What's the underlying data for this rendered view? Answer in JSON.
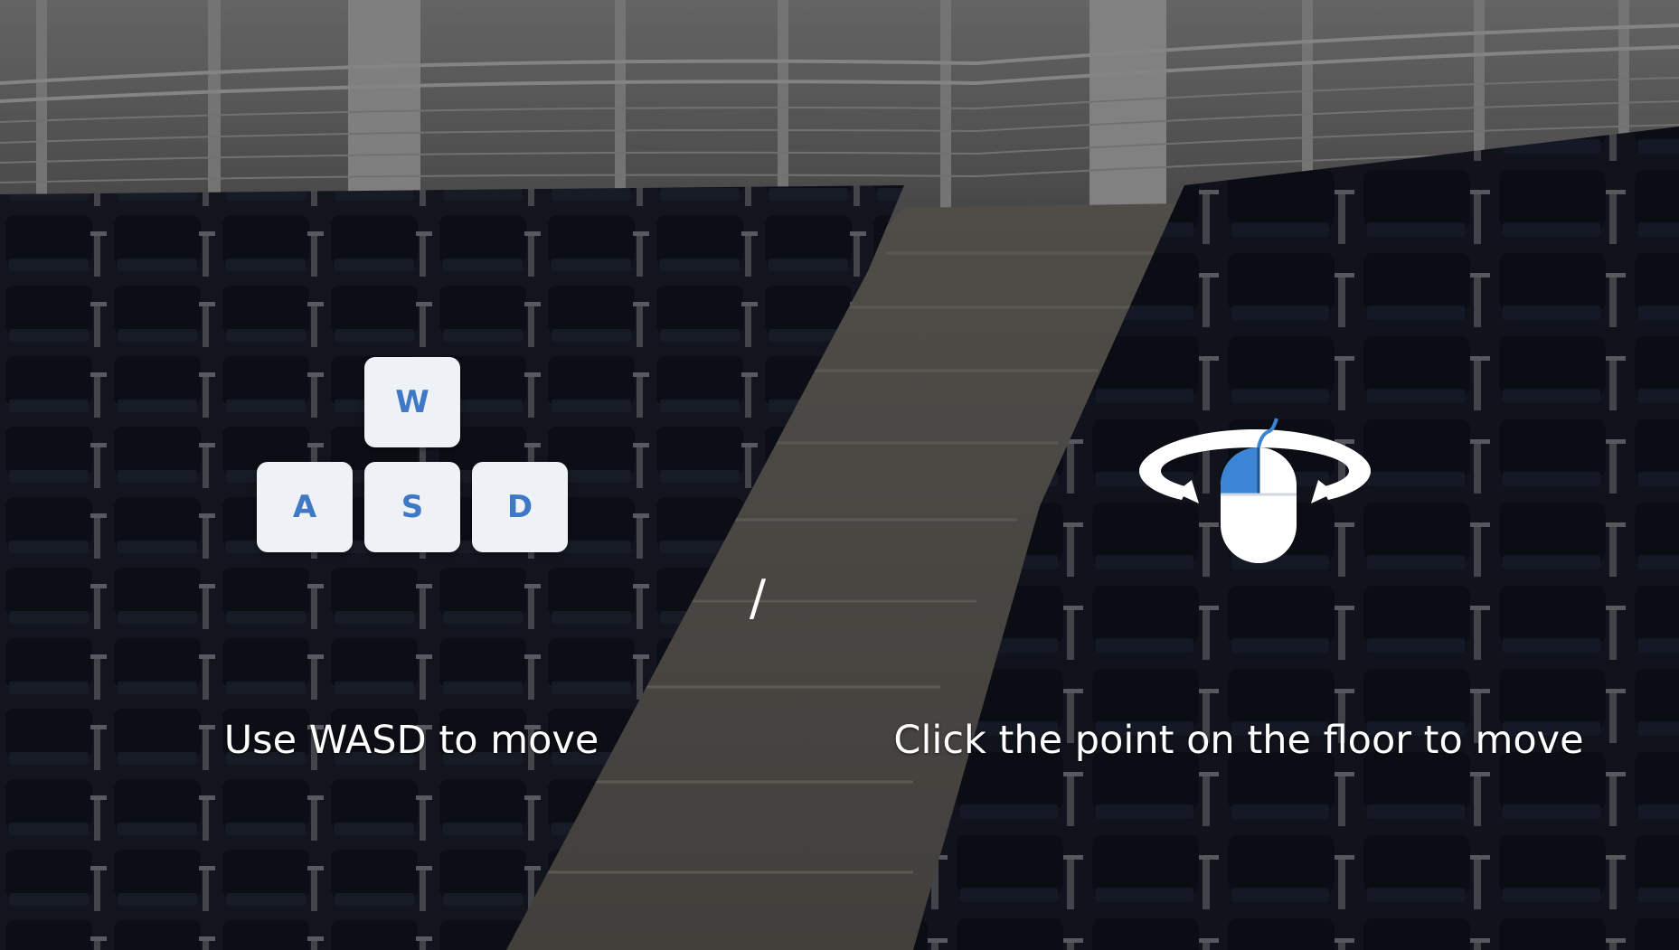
{
  "keyboard_hint": {
    "keys": {
      "w": "W",
      "a": "A",
      "s": "S",
      "d": "D"
    },
    "caption": "Use WASD to move"
  },
  "separator": "/",
  "mouse_hint": {
    "icon": "mouse-click-icon",
    "caption": "Click the point on the floor to move"
  },
  "colors": {
    "key_background": "#eef1f6",
    "key_letter": "#3f78c4",
    "mouse_accent": "#3a86d4",
    "text": "#ffffff"
  }
}
